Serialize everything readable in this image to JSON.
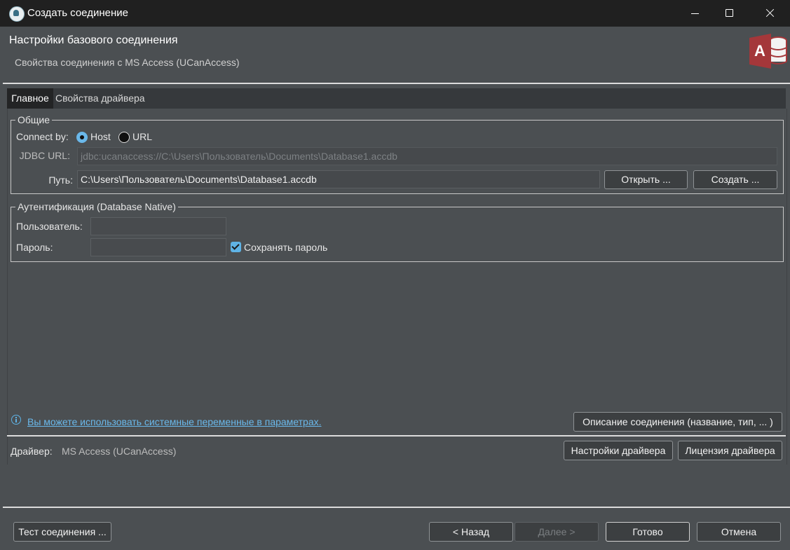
{
  "window": {
    "title": "Создать соединение"
  },
  "header": {
    "title": "Настройки базового соединения",
    "subtitle": "Свойства соединения с MS Access (UCanAccess)",
    "logo_letter": "A"
  },
  "tabs": [
    {
      "label": "Главное",
      "active": true
    },
    {
      "label": "Свойства драйвера",
      "active": false
    }
  ],
  "general": {
    "legend": "Общие",
    "connect_by_label": "Connect by:",
    "option_host": "Host",
    "option_url": "URL",
    "selected": "Host",
    "jdbc_label": "JDBC URL:",
    "jdbc_value": "jdbc:ucanaccess://C:\\Users\\Пользователь\\Documents\\Database1.accdb",
    "path_label": "Путь:",
    "path_value": "C:\\Users\\Пользователь\\Documents\\Database1.accdb",
    "open_button": "Открыть ...",
    "create_button": "Создать ..."
  },
  "auth": {
    "legend": "Аутентификация (Database Native)",
    "user_label": "Пользователь:",
    "user_value": "",
    "password_label": "Пароль:",
    "password_value": "",
    "save_password_label": "Сохранять пароль",
    "save_password_checked": true
  },
  "info": {
    "link_text": "Вы можете использовать системные переменные в параметрах.",
    "description_button": "Описание соединения (название, тип, ... )"
  },
  "driver": {
    "label": "Драйвер:",
    "value": "MS Access (UCanAccess)",
    "settings_button": "Настройки драйвера",
    "license_button": "Лицензия драйвера"
  },
  "footer": {
    "test_button": "Тест соединения ...",
    "back_button": "< Назад",
    "next_button": "Далее >",
    "finish_button": "Готово",
    "cancel_button": "Отмена"
  },
  "colors": {
    "accent": "#6ab8ea",
    "access_logo": "#a4373a"
  }
}
